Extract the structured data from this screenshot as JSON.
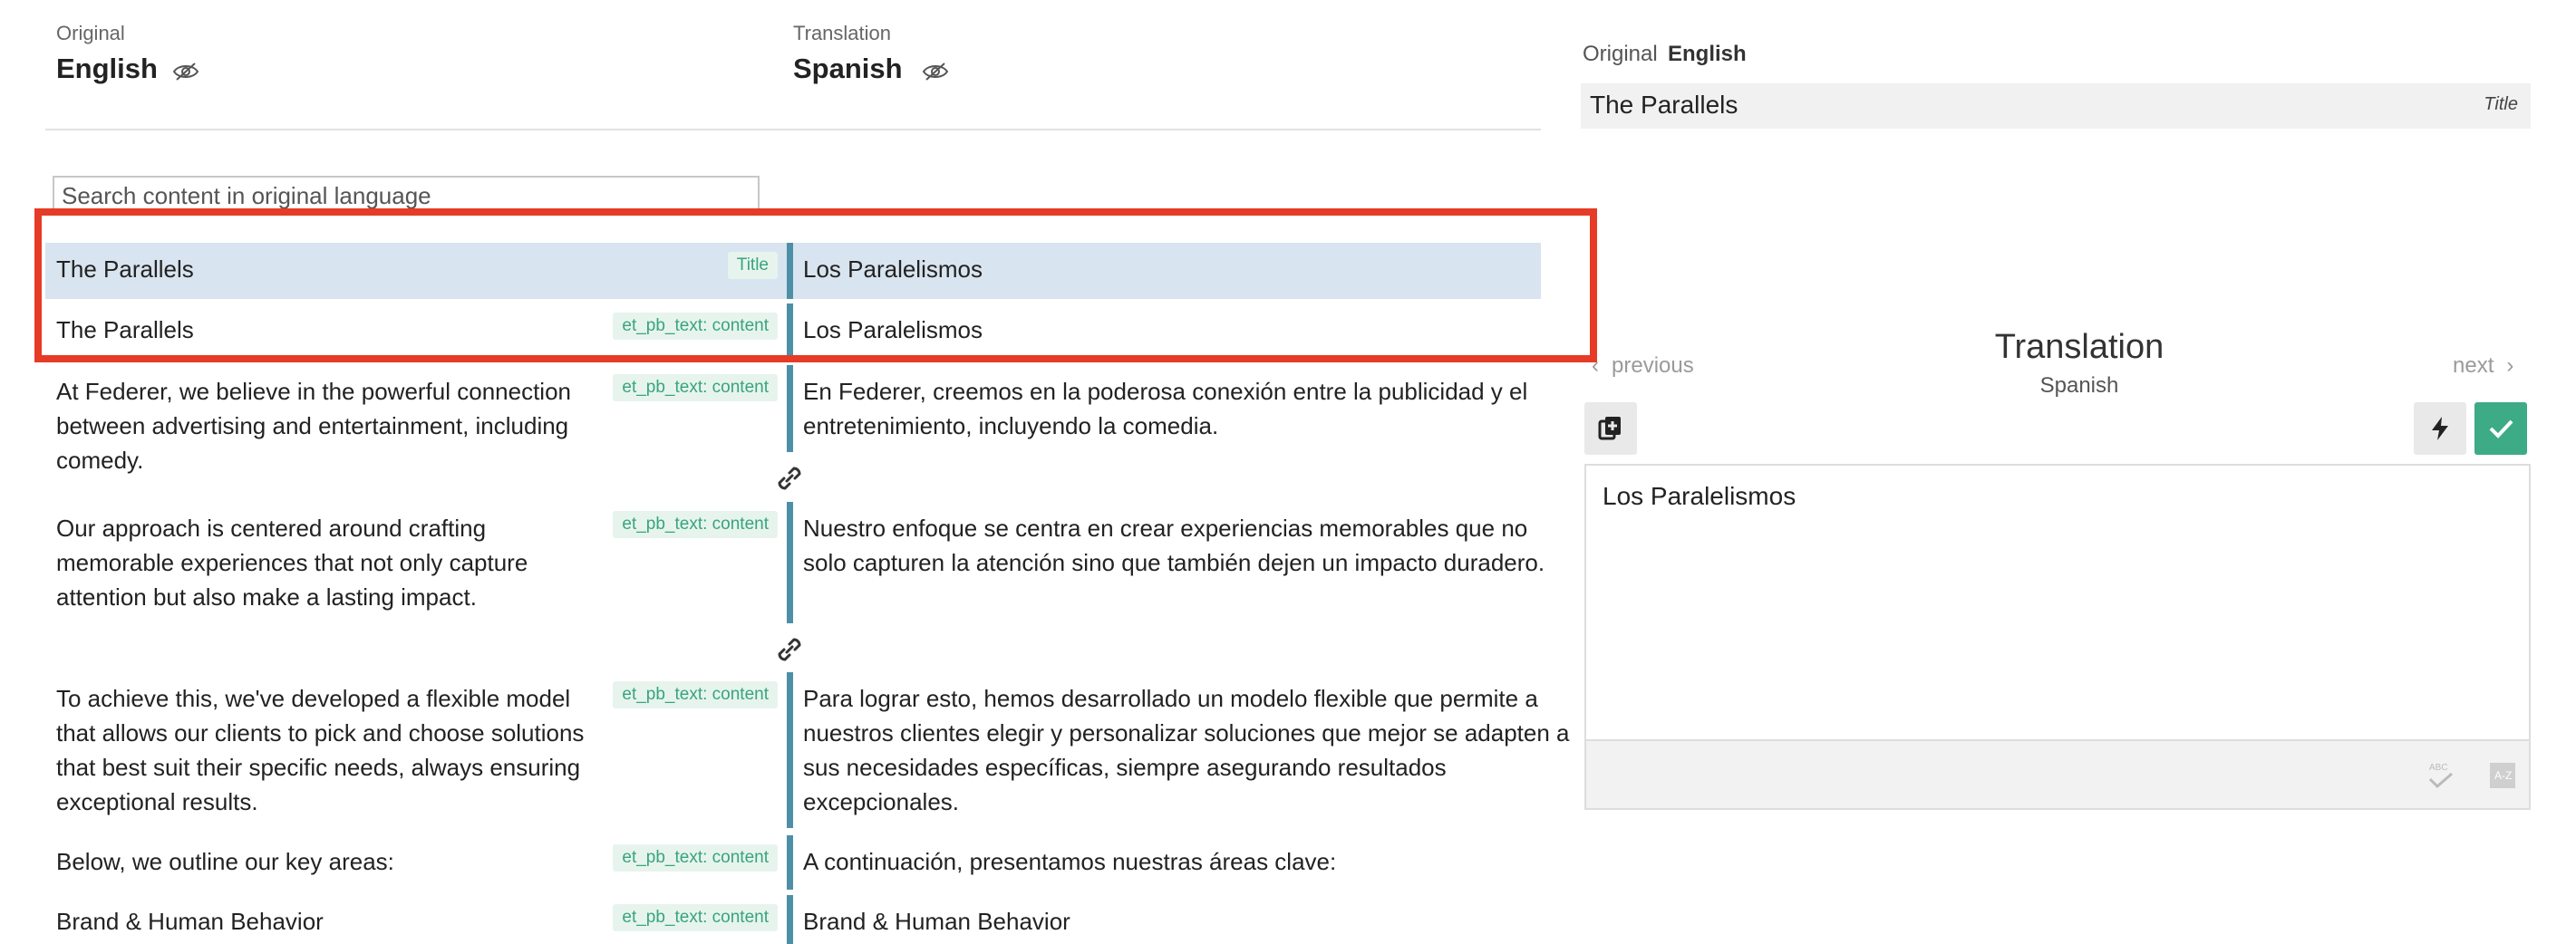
{
  "left_header": {
    "original_caption": "Original",
    "original_language": "English",
    "translation_caption": "Translation",
    "translation_language": "Spanish"
  },
  "search": {
    "placeholder": "Search content in original language",
    "value": ""
  },
  "rows": [
    {
      "original": "The Parallels",
      "tag": "Title",
      "translation": "Los Paralelismos",
      "selected": true
    },
    {
      "original": "The Parallels",
      "tag": "et_pb_text: content",
      "translation": "Los Paralelismos",
      "selected": false
    },
    {
      "original": "At Federer, we believe in the powerful connection between advertising and entertainment, including comedy.",
      "tag": "et_pb_text: content",
      "translation": "En Federer, creemos en la poderosa conexión entre la publicidad y el entretenimiento, incluyendo la comedia.",
      "selected": false
    },
    {
      "original": "Our approach is centered around crafting memorable experiences that not only capture attention but also make a lasting impact.",
      "tag": "et_pb_text: content",
      "translation": "Nuestro enfoque se centra en crear experiencias memorables que no solo capturen la atención sino que también dejen un impacto duradero.",
      "selected": false
    },
    {
      "original": "To achieve this, we've developed a flexible model that allows our clients to pick and choose solutions that best suit their specific needs, always ensuring exceptional results.",
      "tag": "et_pb_text: content",
      "translation": "Para lograr esto, hemos desarrollado un modelo flexible que permite a nuestros clientes elegir y personalizar soluciones que mejor se adapten a sus necesidades específicas, siempre asegurando resultados excepcionales.",
      "selected": false
    },
    {
      "original": "Below, we outline our key areas:",
      "tag": "et_pb_text: content",
      "translation": "A continuación, presentamos nuestras áreas clave:",
      "selected": false
    },
    {
      "original": "Brand & Human Behavior",
      "tag": "et_pb_text: content",
      "translation": "Brand & Human Behavior",
      "selected": false
    }
  ],
  "right_panel": {
    "original_caption": "Original",
    "original_language": "English",
    "original_text": "The Parallels",
    "original_field_label": "Title",
    "previous_label": "previous",
    "next_label": "next",
    "translation_title": "Translation",
    "translation_language": "Spanish",
    "translation_value": "Los Paralelismos"
  },
  "icons": {
    "eye": "eye-slash-icon",
    "link": "link-icon",
    "copy": "copy-original-icon",
    "automatic": "lightning-icon",
    "complete": "check-icon",
    "spellcheck": "spellcheck-icon",
    "glossary": "glossary-icon"
  },
  "colors": {
    "selected_row": "#d8e4ef",
    "divider_bar": "#4e8fa8",
    "tag_text": "#38a57a",
    "tag_background": "#e7f4ee",
    "complete_button": "#3cab86",
    "highlight_border": "#e63b26"
  }
}
